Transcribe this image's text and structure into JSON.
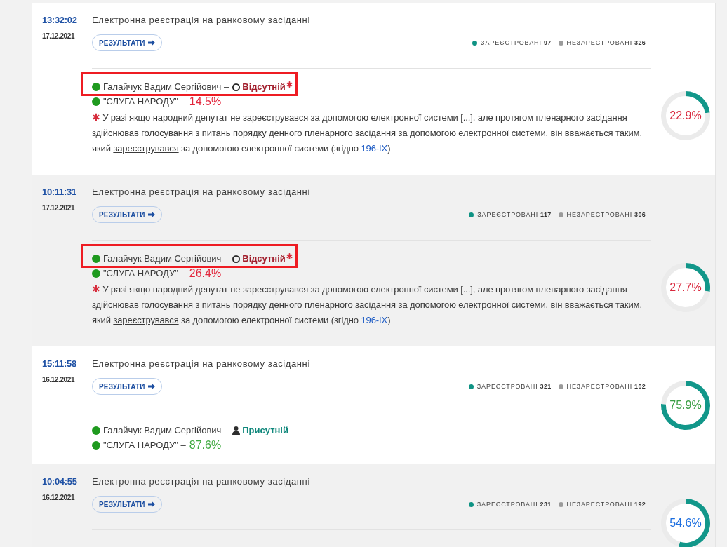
{
  "registrations": [
    {
      "time": "13:32:02",
      "date": "17.12.2021",
      "title": "Електронна реєстрація на ранковому засіданні",
      "button": "РЕЗУЛЬТАТИ",
      "legend": [
        {
          "label": "ЗАРЕЄСТРОВАНІ",
          "count": "97",
          "color": "#0f9384"
        },
        {
          "label": "НЕЗАРЕСТРОВАНІ",
          "count": "326",
          "color": "#9b9b9b"
        }
      ],
      "deputy": {
        "name": "Галайчук Вадим Сергійович –",
        "color": "#1f9a1f",
        "highlighted": true,
        "status": {
          "label": "Відсутній",
          "present": false,
          "starred": true
        }
      },
      "faction": {
        "name": "\"СЛУГА НАРОДУ\" –",
        "color": "#1f9a1f",
        "share": {
          "text": "14.5%",
          "color": "#e2263c"
        }
      },
      "note": [
        {
          "kind": "mark",
          "text": "✱"
        },
        {
          "kind": "text",
          "text": " У разі якщо народний депутат не зареєструвався за допомогою електронної системи [...], але протягом пленарного засідання здійснював голосування з питань порядку денного пленарного засідання за допомогою електронної системи, він вважається таким, який "
        },
        {
          "kind": "term",
          "text": "зареєструвався"
        },
        {
          "kind": "text",
          "text": " за допомогою електронної системи (згідно "
        },
        {
          "kind": "link",
          "text": "196-IX"
        },
        {
          "kind": "text",
          "text": ")"
        }
      ],
      "turnout": {
        "chart_data": {
          "type": "donut",
          "values": [
            22.9,
            77.1
          ]
        },
        "reading": "22.9%",
        "color": "#d9283d"
      }
    },
    {
      "time": "10:11:31",
      "date": "17.12.2021",
      "title": "Електронна реєстрація на ранковому засіданні",
      "button": "РЕЗУЛЬТАТИ",
      "legend": [
        {
          "label": "ЗАРЕЄСТРОВАНІ",
          "count": "117",
          "color": "#0f9384"
        },
        {
          "label": "НЕЗАРЕСТРОВАНІ",
          "count": "306",
          "color": "#9b9b9b"
        }
      ],
      "deputy": {
        "name": "Галайчук Вадим Сергійович –",
        "color": "#1f9a1f",
        "highlighted": true,
        "status": {
          "label": "Відсутній",
          "present": false,
          "starred": true
        }
      },
      "faction": {
        "name": "\"СЛУГА НАРОДУ\" –",
        "color": "#1f9a1f",
        "share": {
          "text": "26.4%",
          "color": "#e2263c"
        }
      },
      "note": [
        {
          "kind": "mark",
          "text": "✱"
        },
        {
          "kind": "text",
          "text": " У разі якщо народний депутат не зареєструвався за допомогою електронної системи [...], але протягом пленарного засідання здійснював голосування з питань порядку денного пленарного засідання за допомогою електронної системи, він вважається таким, який "
        },
        {
          "kind": "term",
          "text": "зареєструвався"
        },
        {
          "kind": "text",
          "text": " за допомогою електронної системи (згідно "
        },
        {
          "kind": "link",
          "text": "196-IX"
        },
        {
          "kind": "text",
          "text": ")"
        }
      ],
      "turnout": {
        "chart_data": {
          "type": "donut",
          "values": [
            27.7,
            72.3
          ]
        },
        "reading": "27.7%",
        "color": "#d9283d"
      }
    },
    {
      "time": "15:11:58",
      "date": "16.12.2021",
      "title": "Електронна реєстрація на ранковому засіданні",
      "button": "РЕЗУЛЬТАТИ",
      "legend": [
        {
          "label": "ЗАРЕЄСТРОВАНІ",
          "count": "321",
          "color": "#0f9384"
        },
        {
          "label": "НЕЗАРЕСТРОВАНІ",
          "count": "102",
          "color": "#9b9b9b"
        }
      ],
      "deputy": {
        "name": "Галайчук Вадим Сергійович –",
        "color": "#1f9a1f",
        "highlighted": false,
        "status": {
          "label": "Присутній",
          "present": true,
          "starred": false
        }
      },
      "faction": {
        "name": "\"СЛУГА НАРОДУ\" –",
        "color": "#1f9a1f",
        "share": {
          "text": "87.6%",
          "color": "#3fa940"
        }
      },
      "turnout": {
        "chart_data": {
          "type": "donut",
          "values": [
            75.9,
            24.1
          ]
        },
        "reading": "75.9%",
        "color": "#3a9f45"
      }
    },
    {
      "time": "10:04:55",
      "date": "16.12.2021",
      "title": "Електронна реєстрація на ранковому засіданні",
      "button": "РЕЗУЛЬТАТИ",
      "legend": [
        {
          "label": "ЗАРЕЄСТРОВАНІ",
          "count": "231",
          "color": "#0f9384"
        },
        {
          "label": "НЕЗАРЕСТРОВАНІ",
          "count": "192",
          "color": "#9b9b9b"
        }
      ],
      "turnout": {
        "chart_data": {
          "type": "donut",
          "values": [
            54.6,
            45.4
          ]
        },
        "reading": "54.6%",
        "color": "#1d6fe0"
      }
    }
  ]
}
